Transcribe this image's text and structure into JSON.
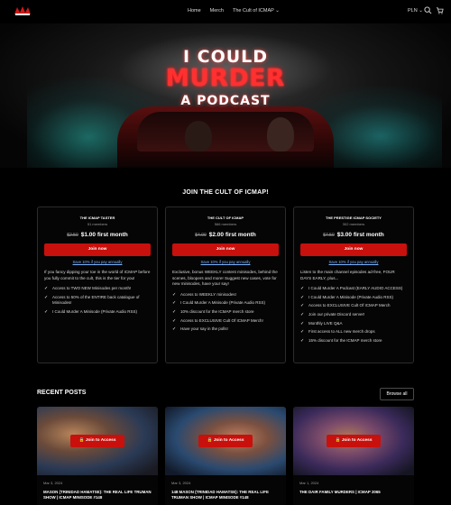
{
  "nav": {
    "items": [
      "Home",
      "Merch",
      "The Cult of ICMAP"
    ],
    "currency": "PLN"
  },
  "hero": {
    "line1": "I COULD",
    "line2": "MURDER",
    "line3": "A PODCAST"
  },
  "join_title": "JOIN THE CULT OF ICMAP!",
  "tiers": [
    {
      "name": "THE ICMAP TASTER",
      "members": "51 members",
      "old_price": "$2.50",
      "price": "$1.00 first month",
      "button": "Join now",
      "save": "Save 10% if you pay annually",
      "desc": "If you fancy dipping your toe in the world of ICMAP before you fully commit to the cult, this is the tier for you!",
      "perks": [
        "Access to TWO NEW Minisodes per month!",
        "Access to 50% of the ENTIRE back catalogue of Minisodes!",
        "I Could Murder A Minisode (Private Audio RSS)"
      ]
    },
    {
      "name": "THE CULT OF ICMAP",
      "members": "566 members",
      "old_price": "$4.00",
      "price": "$2.00 first month",
      "button": "Join now",
      "save": "Save 10% if you pay annually",
      "desc": "Exclusive, bonus WEEKLY content minisodes, behind the scenes, bloopers and more! Suggest new cases, vote for new minisodes, have your say!",
      "perks": [
        "Access to WEEKLY minisodes!",
        "I Could Murder A Minisode (Private Audio RSS)",
        "10% discount for the ICMAP merch store",
        "Access to EXCLUSIVE Cult Of ICMAP Merch!",
        "Have your say in the polls!"
      ]
    },
    {
      "name": "THE PRESTIGE ICMAP SOCIETY",
      "members": "302 members",
      "old_price": "$7.50",
      "price": "$3.00 first month",
      "button": "Join now",
      "save": "Save 10% if you pay annually",
      "desc": "Listen to the main channel episodes ad-free, FOUR DAYS EARLY, plus...",
      "perks": [
        "I Could Murder A Podcast (EARLY AUDIO ACCESS)",
        "I Could Murder A Minisode (Private Audio RSS)",
        "Access to EXCLUSIVE Cult Of ICMAP Merch",
        "Join our private Discord server!",
        "Monthly LIVE Q&A",
        "First access to ALL new merch drops",
        "15% discount for the ICMAP merch store"
      ]
    }
  ],
  "recent": {
    "title": "RECENT POSTS",
    "browse": "Browse all",
    "access_label": "Join to Access",
    "posts": [
      {
        "date": "Mar 3, 2024",
        "title": "MASON (TRINIDAD HAMATSE): THE REAL LIFE TRUMAN SHOW | ICMAP MINISODE #148"
      },
      {
        "date": "Mar 3, 2024",
        "title": "148 MASON (TRINIDAD HAMATSE): THE REAL LIFE TRUMAN SHOW | ICMAP MINISODE #148"
      },
      {
        "date": "Mar 1, 2024",
        "title": "THE DAIR FAMILY MURDERS | ICMAP 2065"
      }
    ]
  }
}
